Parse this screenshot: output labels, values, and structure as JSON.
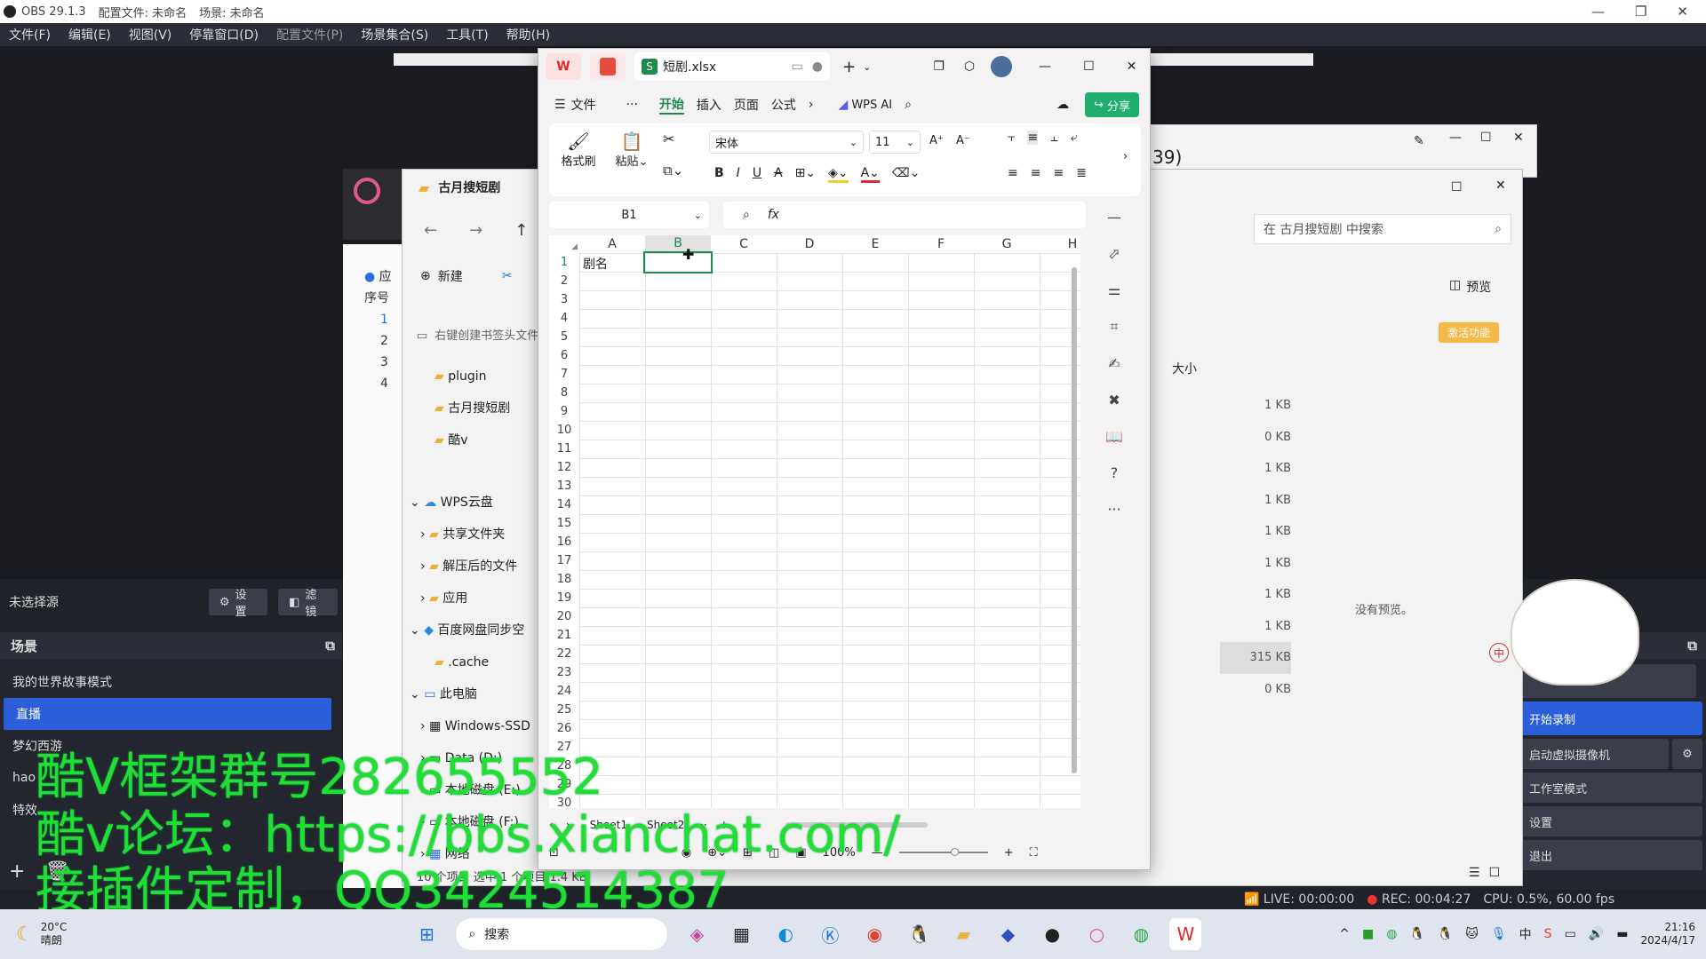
{
  "obs": {
    "title": "OBS 29.1.3",
    "profile": "配置文件: 未命名",
    "scene_collection": "场景: 未命名",
    "menu": [
      "文件(F)",
      "编辑(E)",
      "视图(V)",
      "停靠窗口(D)",
      "配置文件(P)",
      "场景集合(S)",
      "工具(T)",
      "帮助(H)"
    ],
    "no_source": "未选择源",
    "settings_btn": "设置",
    "filters_btn": "滤镜",
    "scenes_header": "场景",
    "scenes": [
      "我的世界故事模式",
      "直播",
      "梦幻西游",
      "hao",
      "特效"
    ],
    "right_controls": [
      "开始录制",
      "启动虚拟摄像机",
      "工作室模式",
      "设置",
      "退出"
    ],
    "status": {
      "live": "LIVE: 00:00:00",
      "rec": "REC: 00:04:27",
      "cpu": "CPU: 0.5%, 60.00 fps"
    }
  },
  "explorer": {
    "title": "古月搜短剧",
    "new_btn": "新建",
    "search_placeholder": "在 古月搜短剧 中搜索",
    "preview_btn": "预览",
    "activate_btn": "激活功能",
    "size_header": "大小",
    "sizes": [
      "1 KB",
      "0 KB",
      "1 KB",
      "1 KB",
      "1 KB",
      "1 KB",
      "1 KB",
      "1 KB",
      "315 KB",
      "0 KB"
    ],
    "no_preview": "没有预览。",
    "bookmark_hint": "右键创建书签头文件",
    "tree": [
      {
        "label": "plugin",
        "indent": 1
      },
      {
        "label": "古月搜短剧",
        "indent": 1
      },
      {
        "label": "酷v",
        "indent": 1
      },
      {
        "label": "WPS云盘",
        "indent": 0
      },
      {
        "label": "共享文件夹",
        "indent": 1
      },
      {
        "label": "解压后的文件",
        "indent": 1
      },
      {
        "label": "应用",
        "indent": 1
      },
      {
        "label": "百度网盘同步空",
        "indent": 0
      },
      {
        "label": ".cache",
        "indent": 1
      },
      {
        "label": "此电脑",
        "indent": 0
      },
      {
        "label": "Windows-SSD",
        "indent": 1
      },
      {
        "label": "Data (D:)",
        "indent": 1
      },
      {
        "label": "本地磁盘 (E:)",
        "indent": 1
      },
      {
        "label": "本地磁盘 (F:)",
        "indent": 1
      },
      {
        "label": "网络",
        "indent": 0
      }
    ],
    "status": "10 个项目  选中 1 个项目 1.4 KB",
    "other_title": "39)",
    "left_header": "序号",
    "left_nums": [
      "1",
      "2",
      "3",
      "4"
    ]
  },
  "wps": {
    "tab_title": "短剧.xlsx",
    "file_menu": "文件",
    "ribbon_tabs": [
      "开始",
      "插入",
      "页面",
      "公式"
    ],
    "wps_ai": "WPS AI",
    "share": "分享",
    "format_painter": "格式刷",
    "paste": "粘贴",
    "font": "宋体",
    "font_size": "11",
    "cell_ref": "B1",
    "fx": "fx",
    "columns": [
      "A",
      "B",
      "C",
      "D",
      "E",
      "F",
      "G",
      "H"
    ],
    "rows": [
      "1",
      "2",
      "3",
      "4",
      "5",
      "6",
      "7",
      "8",
      "9",
      "10",
      "11",
      "12",
      "13",
      "14",
      "15",
      "16",
      "17",
      "18",
      "19",
      "20",
      "21",
      "22",
      "23",
      "24",
      "25",
      "26",
      "27",
      "28",
      "29",
      "30"
    ],
    "a1": "剧名",
    "sheets": [
      "Sheet1",
      "Sheet2"
    ],
    "zoom": "100%"
  },
  "watermark": {
    "line1": "酷V框架群号282655552",
    "line2": "酷v论坛：https://bbs.xianchat.com/",
    "line3": "接插件定制，QQ3424514387"
  },
  "taskbar": {
    "weather_temp": "20°C",
    "weather_desc": "晴朗",
    "search": "搜索",
    "time": "21:16",
    "date": "2024/4/17",
    "ime": "中"
  }
}
